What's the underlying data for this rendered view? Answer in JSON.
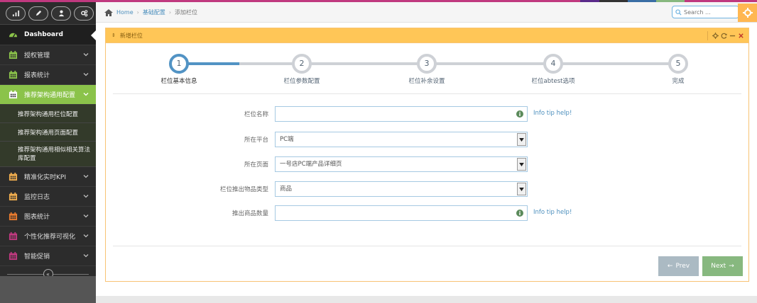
{
  "colors": {
    "top_strip": [
      "#c0397f",
      "#5a2a8a",
      "#333333",
      "#3a6ea5",
      "#87b87f",
      "#c0397f"
    ],
    "sidebar_bg": "#2c2c2c",
    "active_menu": "#8bc34a",
    "widget_header": "#ffc657",
    "step_active": "#5293c4",
    "next_button": "#87b87f",
    "prev_button": "#abbac3"
  },
  "shortcuts": [
    {
      "icon": "bar-chart-icon"
    },
    {
      "icon": "pencil-icon"
    },
    {
      "icon": "users-icon"
    },
    {
      "icon": "cogs-icon"
    }
  ],
  "sidebar": {
    "dashboard": "Dashboard",
    "items": [
      {
        "label": "授权管理",
        "icon": "calendar-icon",
        "color": "#8bc34a"
      },
      {
        "label": "报表统计",
        "icon": "calendar-icon",
        "color": "#8bc34a"
      },
      {
        "label": "推荐架构通用配置",
        "icon": "calendar-icon",
        "color": "#ffffff",
        "active": true
      }
    ],
    "sub_items": [
      "推荐架构通用栏位配置",
      "推荐架构通用页面配置",
      "推荐架构通用相似相关算法库配置"
    ],
    "items_after": [
      {
        "label": "精准化实时KPI",
        "icon": "calendar-icon",
        "color": "#f0ad4e"
      },
      {
        "label": "监控日志",
        "icon": "calendar-icon",
        "color": "#f0ad4e"
      },
      {
        "label": "图表统计",
        "icon": "calendar-icon",
        "color": "#e87b2e"
      },
      {
        "label": "个性化推荐可视化",
        "icon": "calendar-icon",
        "color": "#c0397f"
      },
      {
        "label": "智能促销",
        "icon": "calendar-icon",
        "color": "#c0397f"
      }
    ],
    "collapse_icon": "double-chevron-left-icon"
  },
  "breadcrumb": {
    "home": "Home",
    "section": "基础配置",
    "current": "添加栏位"
  },
  "search": {
    "placeholder": "Search ..."
  },
  "widget": {
    "title": "新增栏位",
    "tools": [
      "gear-icon",
      "refresh-icon",
      "minus-icon",
      "close-icon"
    ]
  },
  "wizard": {
    "steps": [
      {
        "num": "1",
        "label": "栏位基本信息",
        "active": true
      },
      {
        "num": "2",
        "label": "栏位参数配置"
      },
      {
        "num": "3",
        "label": "栏位补余设置"
      },
      {
        "num": "4",
        "label": "栏位abtest选项"
      },
      {
        "num": "5",
        "label": "完成"
      }
    ]
  },
  "form": {
    "fields": [
      {
        "label": "栏位名称",
        "type": "text",
        "value": "",
        "tip": "Info tip help!"
      },
      {
        "label": "所在平台",
        "type": "select",
        "value": "PC端"
      },
      {
        "label": "所在页面",
        "type": "select",
        "value": "一号店PC端产品详细页"
      },
      {
        "label": "栏位推出物品类型",
        "type": "select",
        "value": "商品"
      },
      {
        "label": "推出商品数量",
        "type": "text",
        "value": "",
        "tip": "Info tip help!"
      }
    ]
  },
  "buttons": {
    "prev": "Prev",
    "next": "Next"
  }
}
